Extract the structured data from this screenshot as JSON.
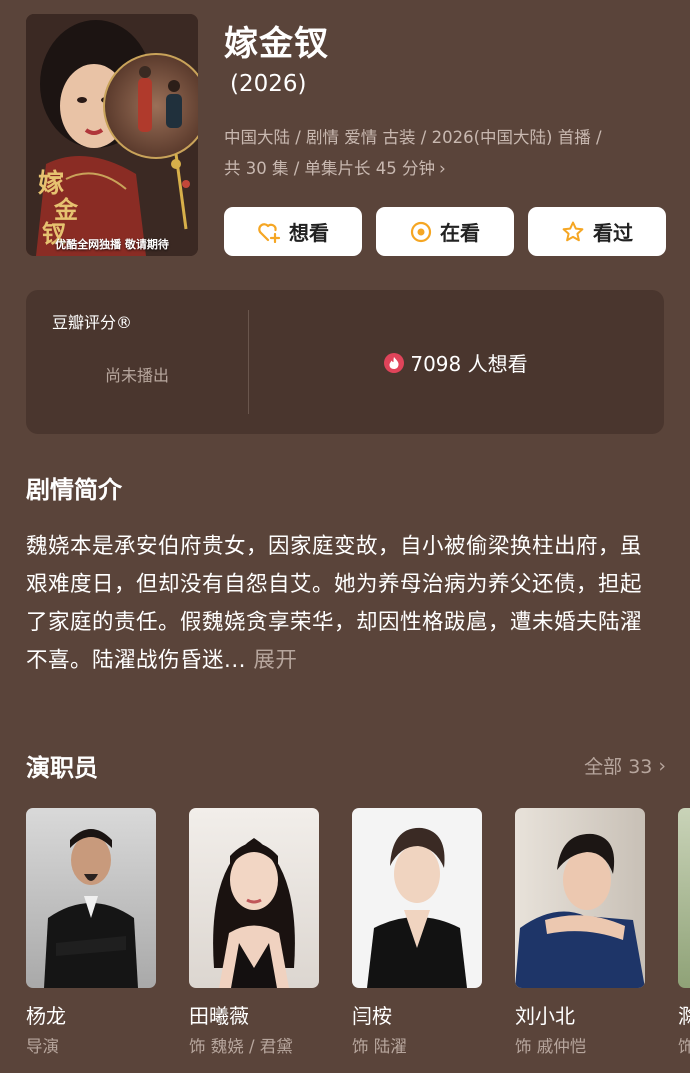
{
  "header": {
    "poster_text": "优酷全网独播 敬请期待",
    "poster_calligraphy": "嫁金钗",
    "title": "嫁金钗",
    "year": "(2026)",
    "meta_line1": "中国大陆 / 剧情 爱情 古装 / 2026(中国大陆) 首播 /",
    "meta_line2": "共 30 集 / 单集片长 45 分钟",
    "meta_chevron": "›"
  },
  "actions": [
    {
      "label": "想看",
      "icon": "heart-plus-icon"
    },
    {
      "label": "在看",
      "icon": "target-icon"
    },
    {
      "label": "看过",
      "icon": "star-icon"
    }
  ],
  "rating": {
    "label": "豆瓣评分®",
    "status": "尚未播出",
    "want_text": "7098 人想看",
    "fire_icon": "fire-icon"
  },
  "synopsis": {
    "heading": "剧情简介",
    "text": "魏娆本是承安伯府贵女，因家庭变故，自小被偷梁换柱出府，虽艰难度日，但却没有自怨自艾。她为养母治病为养父还债，担起了家庭的责任。假魏娆贪享荣华，却因性格跋扈，遭未婚夫陆濯不喜。陆濯战伤昏迷...",
    "expand": " 展开"
  },
  "cast": {
    "heading": "演职员",
    "all_label": "全部 33",
    "chevron": "›",
    "members": [
      {
        "name": "杨龙",
        "role": "导演"
      },
      {
        "name": "田曦薇",
        "role": "饰 魏娆 / 君黛"
      },
      {
        "name": "闫桉",
        "role": "饰 陆濯"
      },
      {
        "name": "刘小北",
        "role": "饰 戚仲恺"
      },
      {
        "name": "滁",
        "role": "饰"
      }
    ]
  },
  "colors": {
    "background": "#5a443a",
    "card": "#4a362e",
    "accent_orange": "#f5a623",
    "fire_red": "#e0445a",
    "muted_text": "#b7a69d"
  }
}
